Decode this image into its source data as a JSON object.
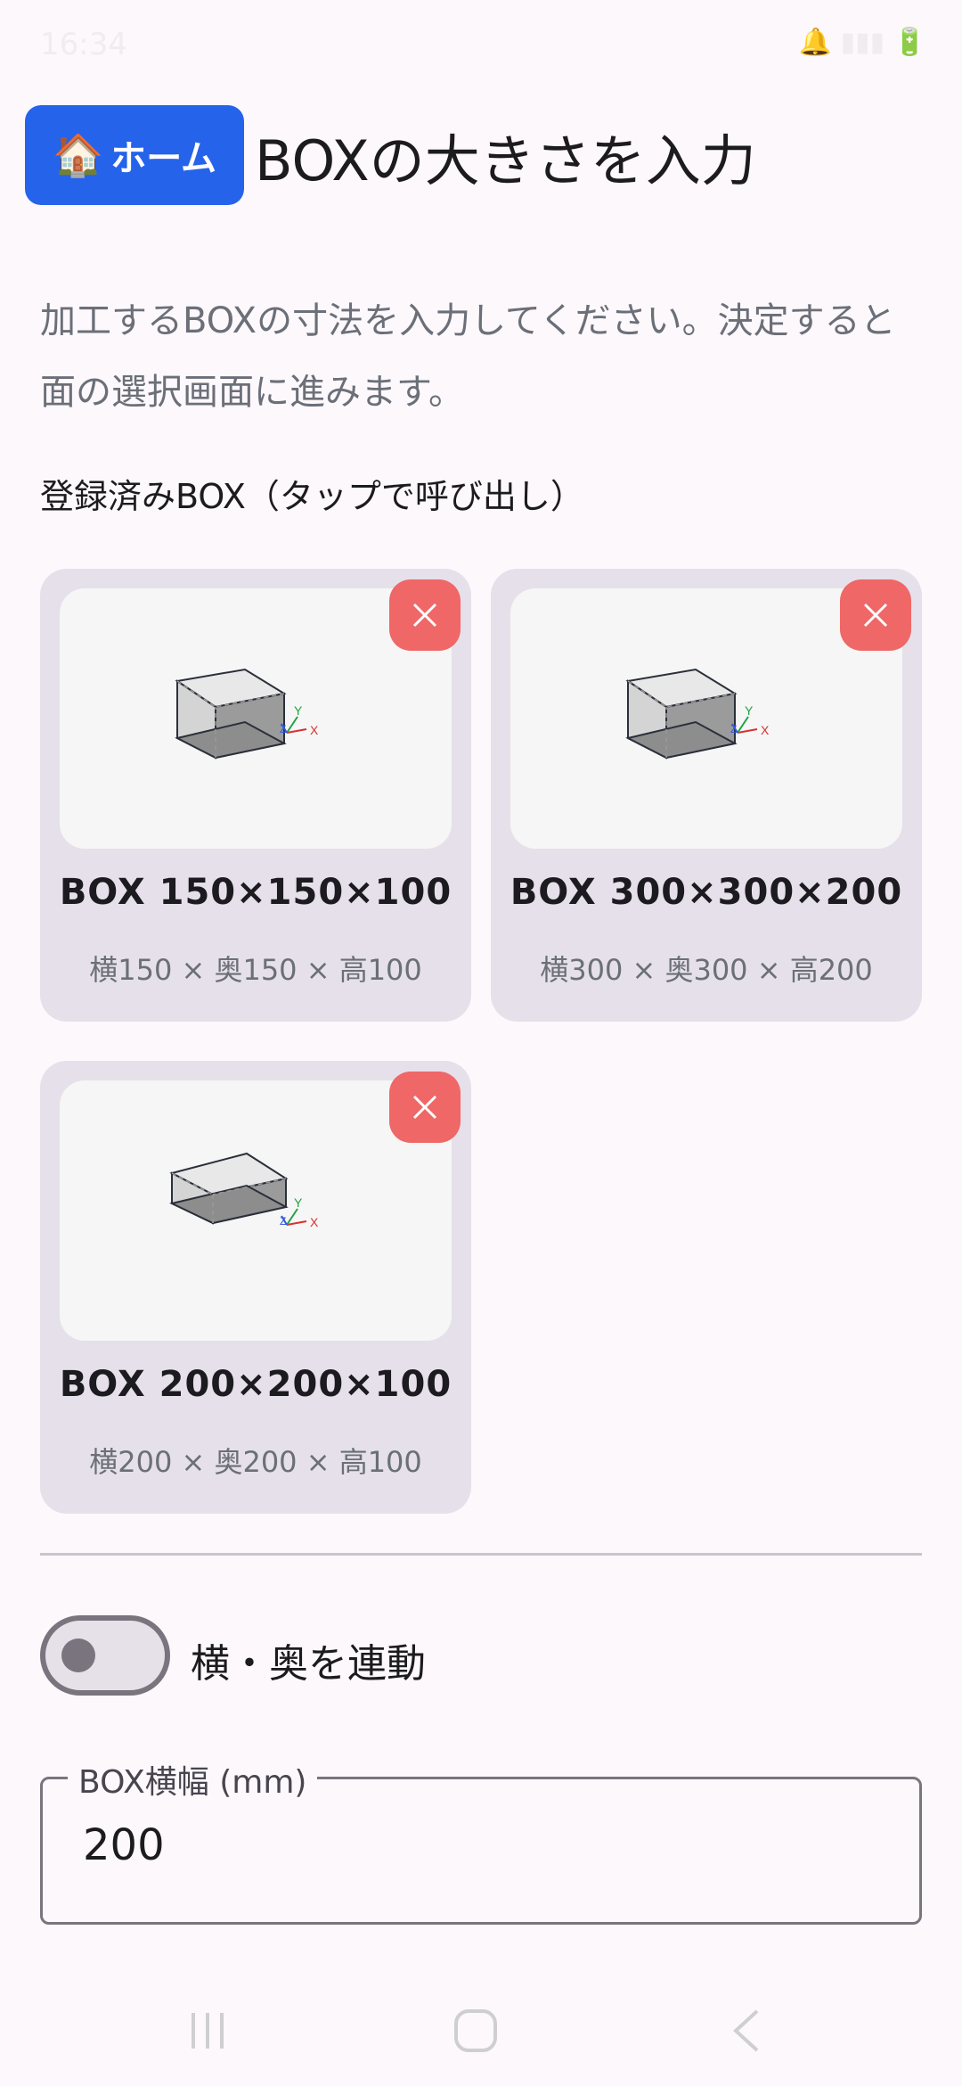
{
  "status_bar": {
    "time": "16:34",
    "icons": "🔔 ▮▮▮ 🔋"
  },
  "header": {
    "home_icon": "🏠",
    "home_label": "ホーム",
    "title": "BOXの大きさを入力"
  },
  "description": "加工するBOXの寸法を入力してください。決定すると面の選択画面に進みます。",
  "saved_section": {
    "label": "登録済みBOX（タップで呼び出し）",
    "boxes": [
      {
        "name": "BOX 150×150×100",
        "dims": "横150 × 奥150 × 高100"
      },
      {
        "name": "BOX 300×300×200",
        "dims": "横300 × 奥300 × 高200"
      },
      {
        "name": "BOX 200×200×100",
        "dims": "横200 × 奥200 × 高100"
      }
    ],
    "axis_labels": {
      "x": "X",
      "y": "Y",
      "z": "Z"
    }
  },
  "link_toggle": {
    "label": "横・奥を連動",
    "state": "off"
  },
  "width_field": {
    "label": "BOX横幅 (mm)",
    "value": "200"
  },
  "colors": {
    "accent": "#2563eb",
    "delete": "#ef6767",
    "card_bg": "#e6e0ea",
    "axis_x": "#d93030",
    "axis_y": "#27a045",
    "axis_z": "#2f58d9"
  },
  "nav_icons": [
    "recent-apps-icon",
    "home-icon",
    "back-icon"
  ]
}
